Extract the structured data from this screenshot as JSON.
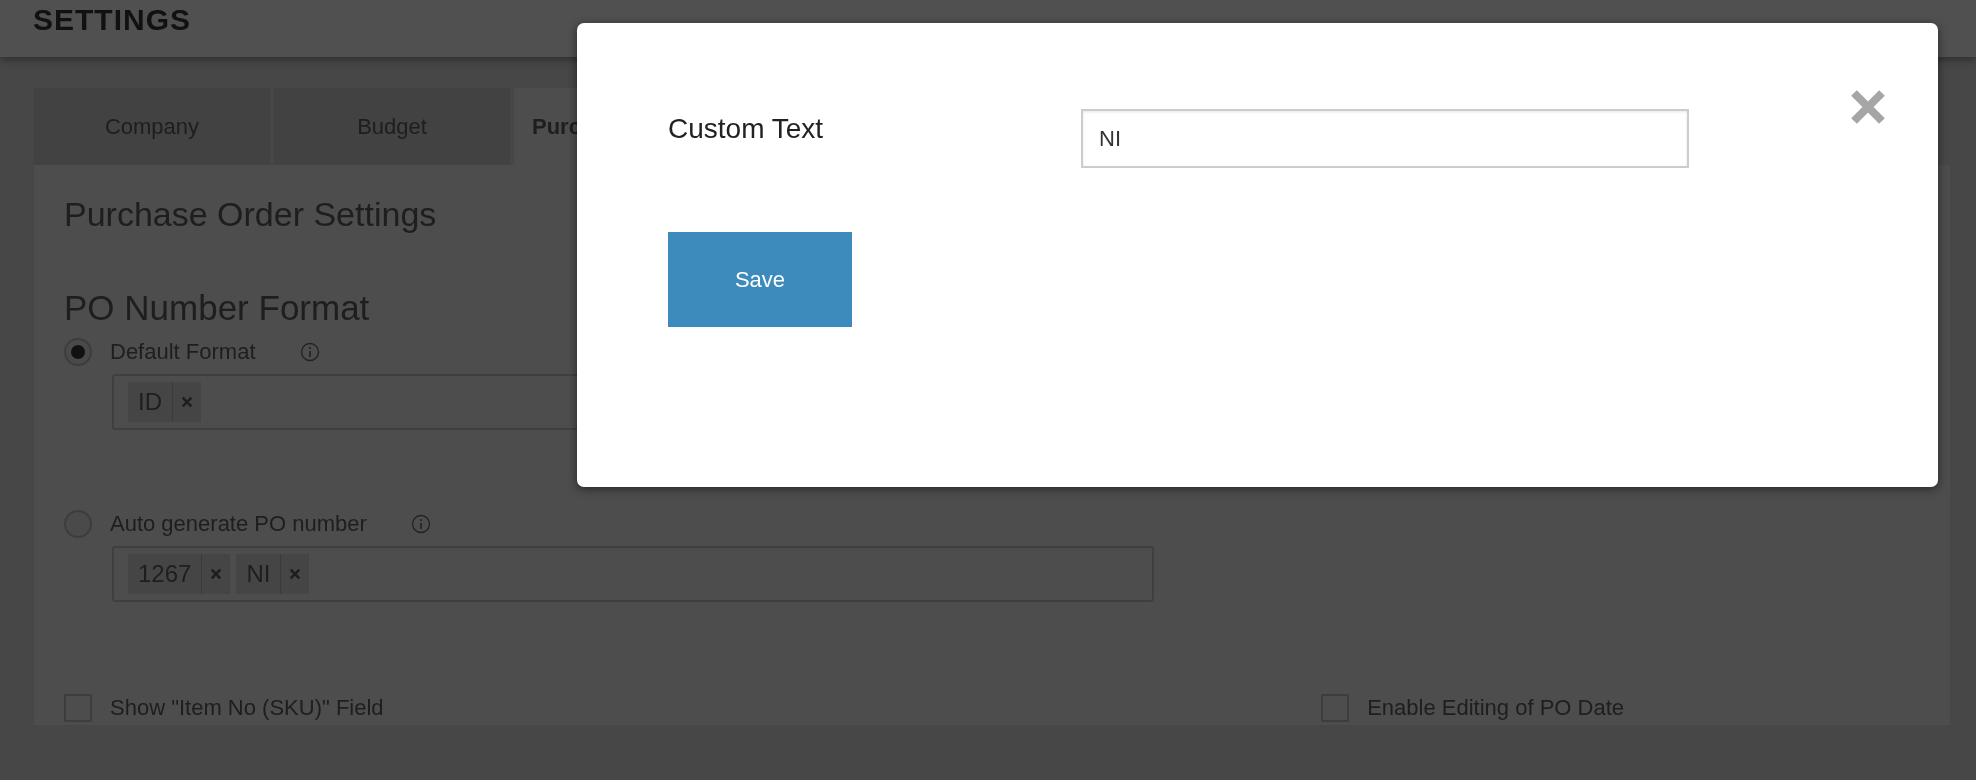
{
  "header": {
    "title": "SETTINGS"
  },
  "tabs": [
    {
      "label": "Company",
      "selected": false
    },
    {
      "label": "Budget",
      "selected": false
    },
    {
      "label": "Purc",
      "selected": true
    }
  ],
  "section_title": "Purchase Order Settings",
  "po_format": {
    "title": "PO Number Format",
    "options": [
      {
        "label": "Default Format",
        "selected": true,
        "tags": [
          "ID"
        ]
      },
      {
        "label": "Auto generate PO number",
        "selected": false,
        "tags": [
          "1267",
          "NI"
        ]
      }
    ]
  },
  "checkboxes": [
    {
      "label": "Show \"Item No (SKU)\" Field",
      "checked": false
    },
    {
      "label": "Enable Editing of PO Date",
      "checked": false
    }
  ],
  "modal": {
    "field_label": "Custom Text",
    "field_value": "NI",
    "save_label": "Save"
  }
}
